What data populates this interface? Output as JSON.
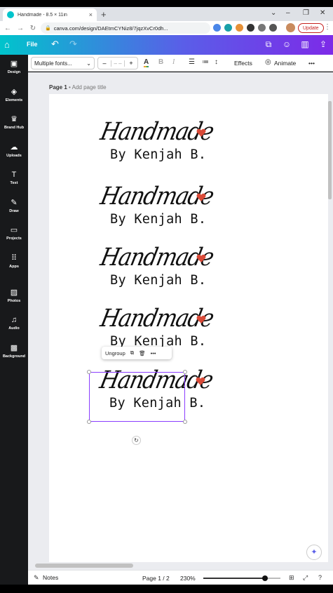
{
  "browser": {
    "tab_title": "Handmade - 8.5 × 11in",
    "tab_close": "×",
    "new_tab": "+",
    "url": "canva.com/design/DAEtmCYNiz8/7jqzXvCr0dh...",
    "update_label": "Update"
  },
  "canva_header": {
    "file_label": "File"
  },
  "sidebar": {
    "items": [
      {
        "label": "Design",
        "icon": "▣"
      },
      {
        "label": "Elements",
        "icon": "◈"
      },
      {
        "label": "Brand Hub",
        "icon": "♛"
      },
      {
        "label": "Uploads",
        "icon": "☁"
      },
      {
        "label": "Text",
        "icon": "T"
      },
      {
        "label": "Draw",
        "icon": "✎"
      },
      {
        "label": "Projects",
        "icon": "▭"
      },
      {
        "label": "Apps",
        "icon": "⠿"
      },
      {
        "label": "Photos",
        "icon": "▨"
      },
      {
        "label": "Audio",
        "icon": "♫"
      },
      {
        "label": "Background",
        "icon": "▩"
      }
    ]
  },
  "toolbar": {
    "font": "Multiple fonts...",
    "size_minus": "–",
    "size_value": "– –",
    "size_plus": "+",
    "effects_label": "Effects",
    "animate_label": "Animate",
    "more": "•••"
  },
  "workspace": {
    "page_label": "Page 1",
    "page_title_placeholder": "• Add page title",
    "logos": [
      {
        "script": "Handmade",
        "byline": "By Kenjah B."
      },
      {
        "script": "Handmade",
        "byline": "By Kenjah B."
      },
      {
        "script": "Handmade",
        "byline": "By Kenjah B."
      },
      {
        "script": "Handmade",
        "byline": "By Kenjah B."
      },
      {
        "script": "Handmade",
        "byline": "By Kenjah B."
      }
    ],
    "context_menu": {
      "ungroup_label": "Ungroup",
      "more": "•••"
    }
  },
  "footer": {
    "notes_label": "Notes",
    "page_indicator": "Page 1 / 2",
    "zoom_label": "230%",
    "zoom_fraction": 0.8
  },
  "colors": {
    "heart": "#d94a38",
    "selection": "#8b3dff",
    "header_start": "#00c4cc",
    "header_end": "#7d2ae8"
  }
}
